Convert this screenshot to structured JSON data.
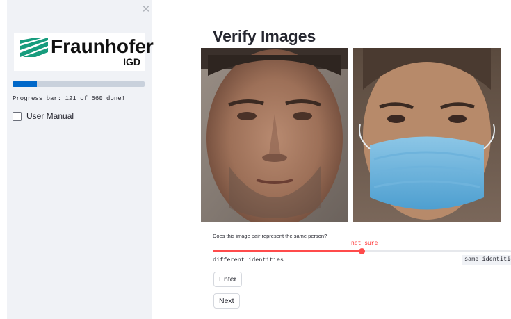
{
  "sidebar": {
    "close_icon": "close-icon",
    "logo": {
      "name": "Fraunhofer",
      "sub": "IGD",
      "color": "#179c7d"
    },
    "progress": {
      "done": 121,
      "total": 660,
      "fraction": 0.183,
      "text": "Progress bar: 121 of 660 done!",
      "color": "#0068c9"
    },
    "user_manual": {
      "label": "User Manual",
      "checked": false
    }
  },
  "main": {
    "title": "Verify Images",
    "left_image": "face-photo",
    "right_image": "masked-face-photo",
    "question": "Does this image pair represent the same person?",
    "slider": {
      "value_label": "not sure",
      "min_label": "different identities",
      "max_label": "same identities",
      "position": 0.5,
      "color": "#ff4b4b"
    },
    "buttons": {
      "enter": "Enter",
      "next": "Next"
    }
  }
}
